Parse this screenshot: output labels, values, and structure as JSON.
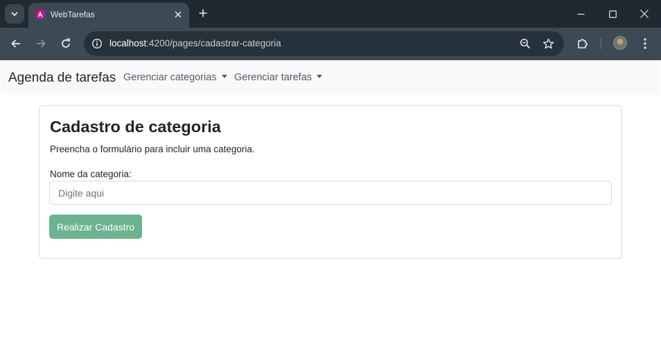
{
  "browser": {
    "tab_title": "WebTarefas",
    "url_host": "localhost",
    "url_path": ":4200/pages/cadastrar-categoria",
    "colors": {
      "titlebar": "#202830",
      "toolbar": "#3c4a55",
      "omnibox": "#26323b"
    }
  },
  "navbar": {
    "brand": "Agenda de tarefas",
    "menu_categorias": "Gerenciar categorias",
    "menu_tarefas": "Gerenciar tarefas"
  },
  "form": {
    "title": "Cadastro de categoria",
    "description": "Preencha o formulário para incluir uma categoria.",
    "field_label": "Nome da categoria:",
    "field_placeholder": "Digite aqui",
    "field_value": "",
    "submit_label": "Realizar Cadastro",
    "submit_color": "#6bb390"
  }
}
